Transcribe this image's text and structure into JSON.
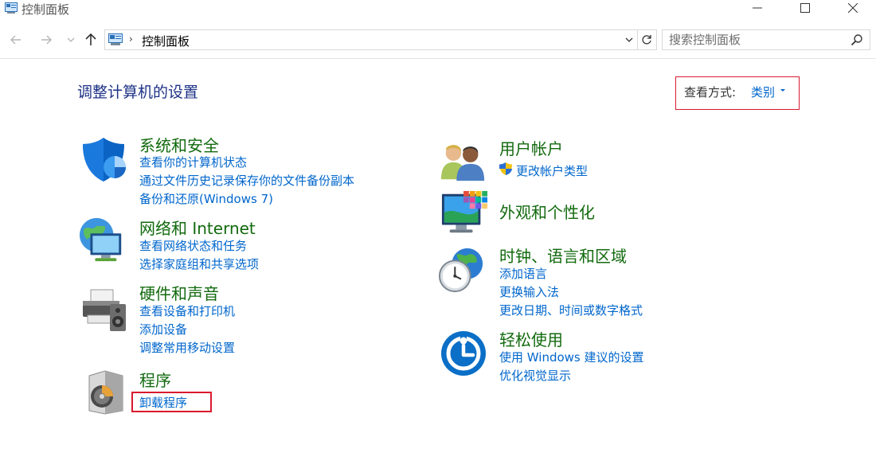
{
  "window": {
    "title": "控制面板"
  },
  "address_bar": {
    "path": "控制面板",
    "separator": "›"
  },
  "search": {
    "placeholder": "搜索控制面板"
  },
  "main": {
    "heading": "调整计算机的设置",
    "view_by": {
      "label": "查看方式:",
      "value": "类别"
    }
  },
  "categories": [
    {
      "title": "系统和安全",
      "icon": "shield-icon",
      "links": [
        "查看你的计算机状态",
        "通过文件历史记录保存你的文件备份副本",
        "备份和还原(Windows 7)"
      ]
    },
    {
      "title": "网络和 Internet",
      "icon": "network-globe-icon",
      "links": [
        "查看网络状态和任务",
        "选择家庭组和共享选项"
      ]
    },
    {
      "title": "硬件和声音",
      "icon": "printer-speaker-icon",
      "links": [
        "查看设备和打印机",
        "添加设备",
        "调整常用移动设置"
      ]
    },
    {
      "title": "程序",
      "icon": "programs-disc-icon",
      "links": [
        "卸载程序"
      ]
    },
    {
      "title": "用户帐户",
      "icon": "users-icon",
      "links": [
        "更改帐户类型"
      ]
    },
    {
      "title": "外观和个性化",
      "icon": "monitor-palette-icon",
      "links": []
    },
    {
      "title": "时钟、语言和区域",
      "icon": "clock-globe-icon",
      "links": [
        "添加语言",
        "更换输入法",
        "更改日期、时间或数字格式"
      ]
    },
    {
      "title": "轻松使用",
      "icon": "ease-of-access-icon",
      "links": [
        "使用 Windows 建议的设置",
        "优化视觉显示"
      ]
    }
  ],
  "colors": {
    "category_title": "#126a0e",
    "link": "#0066cc",
    "heading": "#1e3287",
    "highlight": "#d9192e"
  }
}
